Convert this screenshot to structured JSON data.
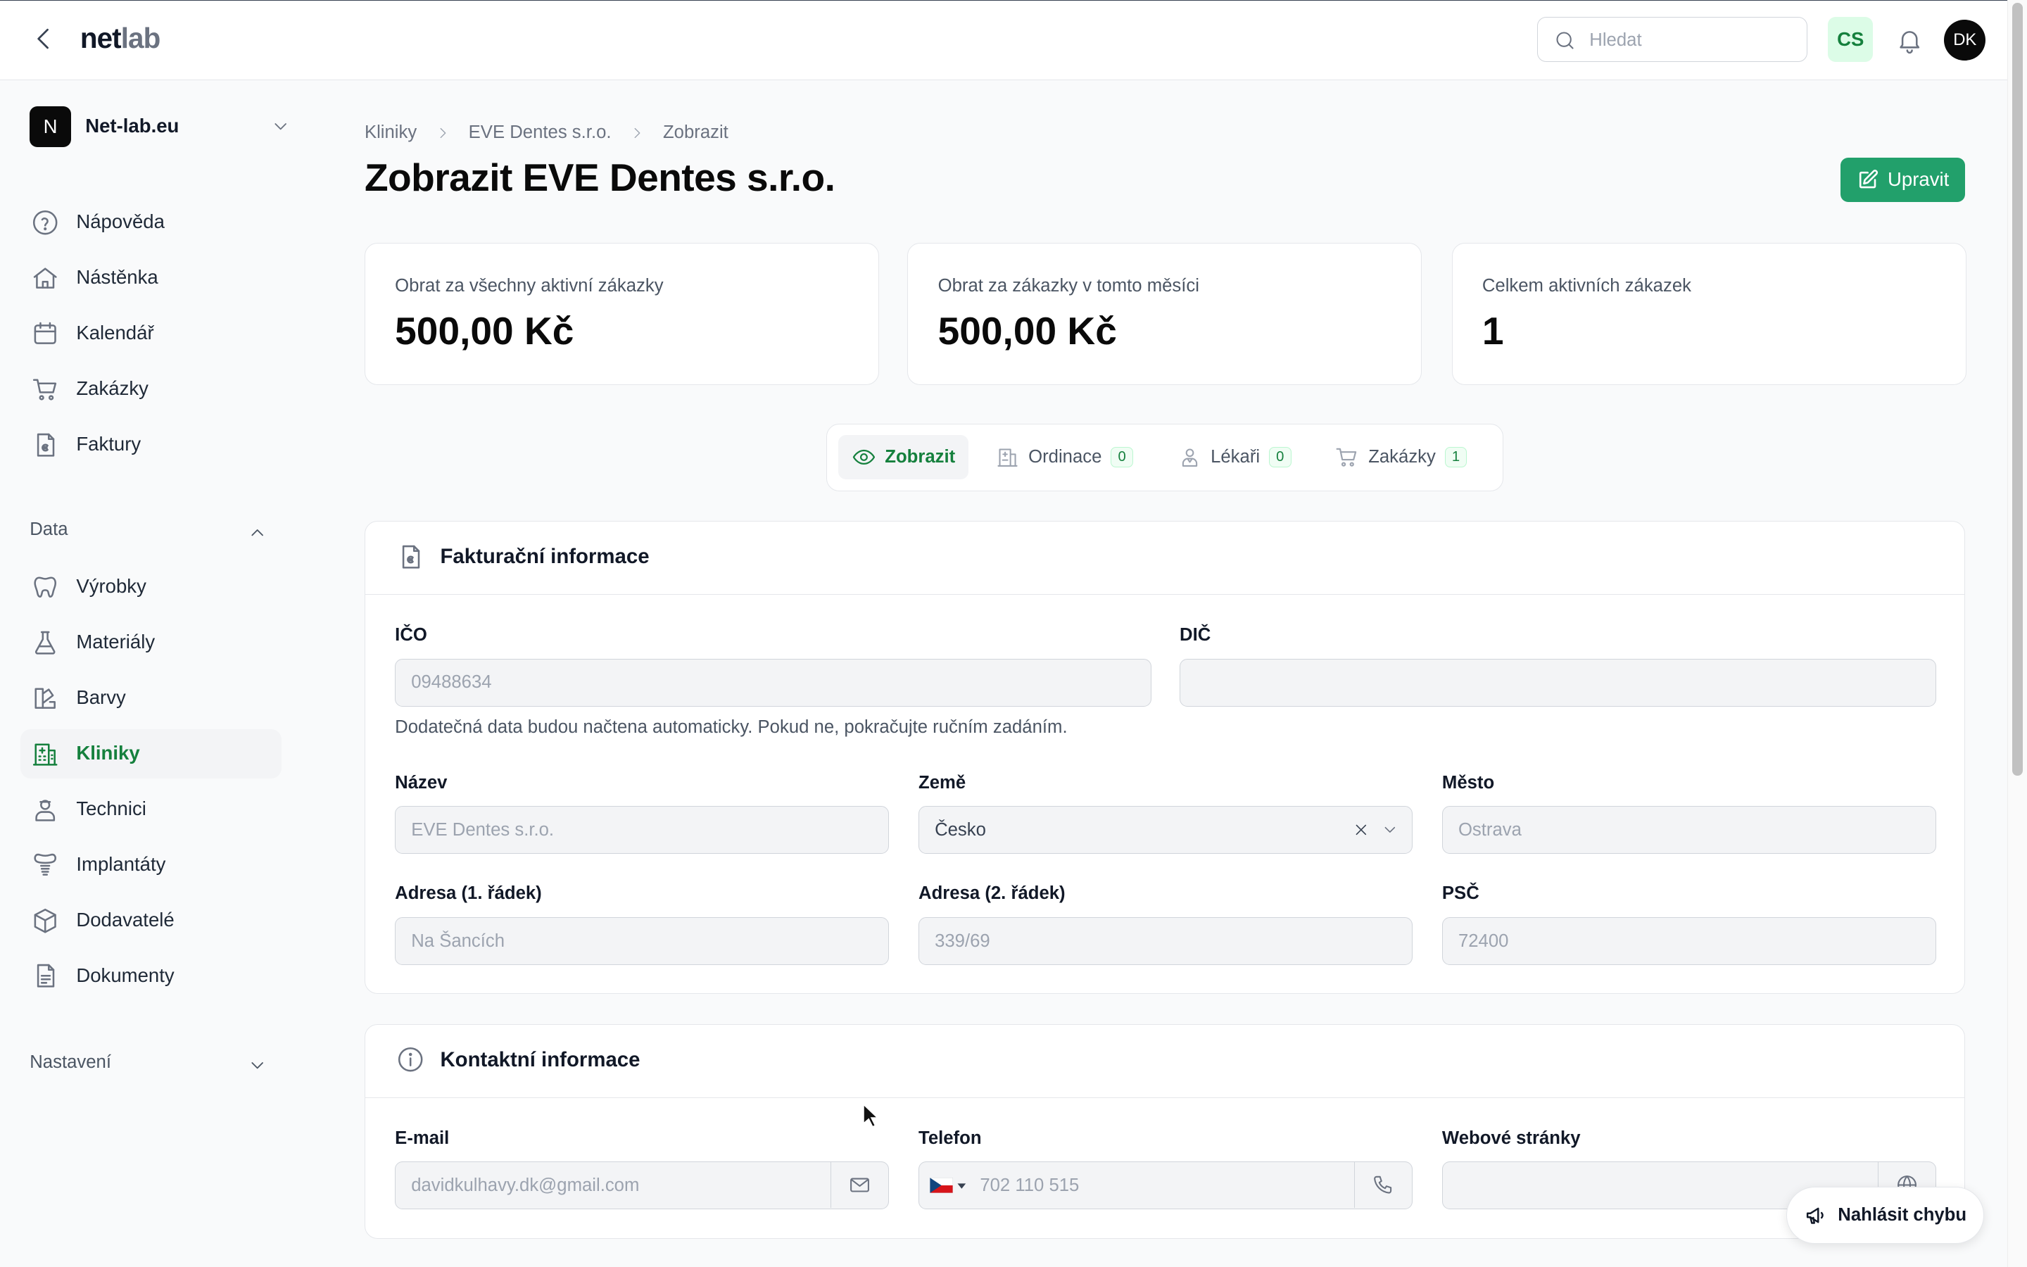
{
  "header": {
    "logo_part1": "net",
    "logo_part2": "lab",
    "search_placeholder": "Hledat",
    "language": "CS",
    "user_initials": "DK"
  },
  "sidebar": {
    "org_initial": "N",
    "org_name": "Net-lab.eu",
    "main_items": [
      {
        "label": "Nápověda",
        "icon": "help-circle-icon"
      },
      {
        "label": "Nástěnka",
        "icon": "home-icon"
      },
      {
        "label": "Kalendář",
        "icon": "calendar-icon"
      },
      {
        "label": "Zakázky",
        "icon": "cart-icon"
      },
      {
        "label": "Faktury",
        "icon": "invoice-icon"
      }
    ],
    "data_section": "Data",
    "data_items": [
      {
        "label": "Výrobky",
        "icon": "tooth-icon"
      },
      {
        "label": "Materiály",
        "icon": "flask-icon"
      },
      {
        "label": "Barvy",
        "icon": "swatch-icon"
      },
      {
        "label": "Kliniky",
        "icon": "hospital-icon",
        "active": true
      },
      {
        "label": "Technici",
        "icon": "technician-icon"
      },
      {
        "label": "Implantáty",
        "icon": "implant-icon"
      },
      {
        "label": "Dodavatelé",
        "icon": "box-icon"
      },
      {
        "label": "Dokumenty",
        "icon": "document-icon"
      }
    ],
    "settings_section": "Nastavení"
  },
  "breadcrumb": [
    "Kliniky",
    "EVE Dentes s.r.o.",
    "Zobrazit"
  ],
  "page_title": "Zobrazit EVE Dentes s.r.o.",
  "edit_button": "Upravit",
  "stats": [
    {
      "label": "Obrat za všechny aktivní zákazky",
      "value": "500,00 Kč"
    },
    {
      "label": "Obrat za zákazky v tomto měsíci",
      "value": "500,00 Kč"
    },
    {
      "label": "Celkem aktivních zákazek",
      "value": "1"
    }
  ],
  "tabs": [
    {
      "label": "Zobrazit",
      "icon": "eye-icon",
      "active": true
    },
    {
      "label": "Ordinace",
      "icon": "building-icon",
      "count": "0"
    },
    {
      "label": "Lékaři",
      "icon": "doctor-icon",
      "count": "0"
    },
    {
      "label": "Zakázky",
      "icon": "cart-icon",
      "count": "1"
    }
  ],
  "billing": {
    "title": "Fakturační informace",
    "ico_label": "IČO",
    "ico_value": "09488634",
    "dic_label": "DIČ",
    "dic_value": "",
    "hint": "Dodatečná data budou načtena automaticky. Pokud ne, pokračujte ručním zadáním.",
    "name_label": "Název",
    "name_value": "EVE Dentes s.r.o.",
    "country_label": "Země",
    "country_value": "Česko",
    "city_label": "Město",
    "city_value": "Ostrava",
    "addr1_label": "Adresa (1. řádek)",
    "addr1_value": "Na Šancích",
    "addr2_label": "Adresa (2. řádek)",
    "addr2_value": "339/69",
    "zip_label": "PSČ",
    "zip_value": "72400"
  },
  "contact": {
    "title": "Kontaktní informace",
    "email_label": "E-mail",
    "email_value": "davidkulhavy.dk@gmail.com",
    "phone_label": "Telefon",
    "phone_value": "702 110 515",
    "web_label": "Webové stránky",
    "web_value": ""
  },
  "report_button": "Nahlásit chybu",
  "colors": {
    "accent": "#22a06b",
    "active_text": "#15803d"
  }
}
